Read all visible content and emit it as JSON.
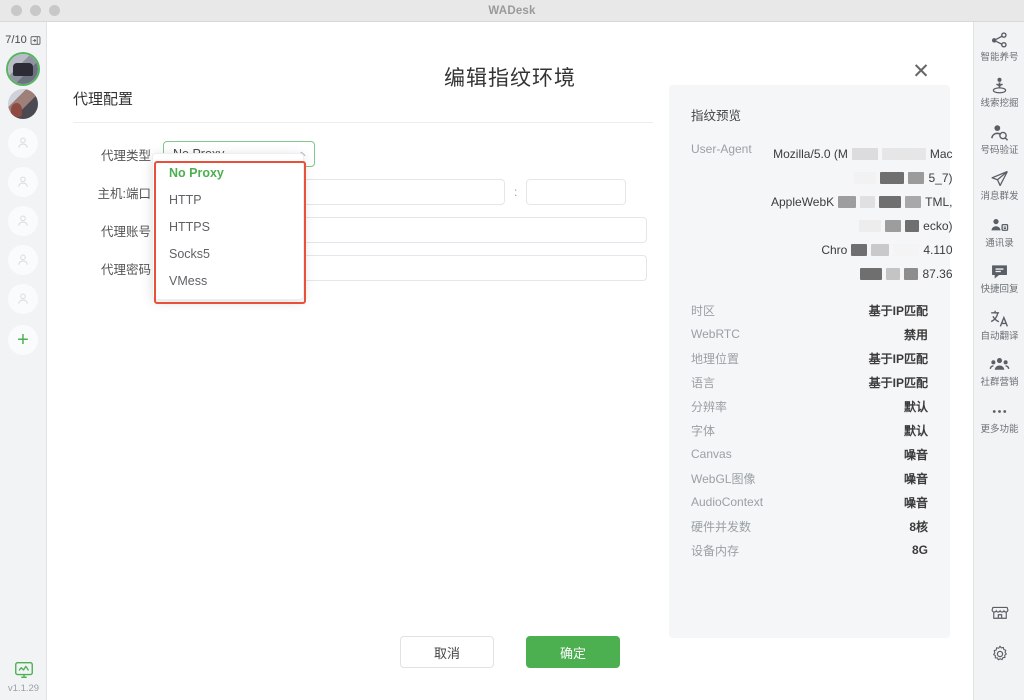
{
  "window": {
    "title": "WADesk"
  },
  "sidebar": {
    "counter": "7/10",
    "collapse_icon": "collapse-panel-icon",
    "version": "v1.1.29",
    "add_label": "+",
    "accounts": [
      {
        "name": "account-avatar-active",
        "active": true
      },
      {
        "name": "account-avatar-secondary",
        "active": false
      }
    ],
    "placeholders": 5
  },
  "rail": {
    "items": [
      {
        "label": "智能养号",
        "icon": "share-nodes-icon"
      },
      {
        "label": "线索挖掘",
        "icon": "person-radar-icon"
      },
      {
        "label": "号码验证",
        "icon": "person-search-icon"
      },
      {
        "label": "消息群发",
        "icon": "paper-plane-icon"
      },
      {
        "label": "通讯录",
        "icon": "contacts-icon"
      },
      {
        "label": "快捷回复",
        "icon": "chat-bubble-icon"
      },
      {
        "label": "自动翻译",
        "icon": "translate-icon"
      },
      {
        "label": "社群营销",
        "icon": "group-people-icon"
      },
      {
        "label": "更多功能",
        "icon": "ellipsis-icon"
      }
    ],
    "bottom": [
      {
        "icon": "store-icon"
      },
      {
        "icon": "gear-icon"
      }
    ]
  },
  "modal": {
    "title": "编辑指纹环境",
    "close_icon": "close-icon",
    "section_title": "代理配置",
    "fields": {
      "proxy_type_label": "代理类型",
      "proxy_type_value": "No Proxy",
      "host_port_label": "主机:端口",
      "host_value": "",
      "host_placeholder": "",
      "port_value": "",
      "port_placeholder": "",
      "separator": ":",
      "account_label": "代理账号",
      "account_value": "",
      "account_placeholder": "",
      "password_label": "代理密码",
      "password_value": "",
      "password_placeholder": ""
    },
    "dropdown": {
      "open": true,
      "selected": "No Proxy",
      "options": [
        "No Proxy",
        "HTTP",
        "HTTPS",
        "Socks5",
        "VMess"
      ],
      "highlight_color": "#e8503a"
    },
    "buttons": {
      "cancel": "取消",
      "confirm": "确定",
      "confirm_color": "#4caf50"
    }
  },
  "preview": {
    "title": "指纹预览",
    "user_agent": {
      "key": "User-Agent",
      "lines": [
        {
          "pre": "Mozilla/5.0 (M",
          "post": "Mac"
        },
        {
          "pre": "",
          "post": "5_7)"
        },
        {
          "pre": "AppleWebK",
          "post": "TML,"
        },
        {
          "pre": "",
          "post": "ecko)"
        },
        {
          "pre": "Chro",
          "post": "4.110"
        },
        {
          "pre": "",
          "post": "87.36"
        }
      ]
    },
    "rows": [
      {
        "key": "时区",
        "value": "基于IP匹配"
      },
      {
        "key": "WebRTC",
        "value": "禁用"
      },
      {
        "key": "地理位置",
        "value": "基于IP匹配"
      },
      {
        "key": "语言",
        "value": "基于IP匹配"
      },
      {
        "key": "分辨率",
        "value": "默认"
      },
      {
        "key": "字体",
        "value": "默认"
      },
      {
        "key": "Canvas",
        "value": "噪音"
      },
      {
        "key": "WebGL图像",
        "value": "噪音"
      },
      {
        "key": "AudioContext",
        "value": "噪音"
      },
      {
        "key": "硬件并发数",
        "value": "8核"
      },
      {
        "key": "设备内存",
        "value": "8G"
      }
    ]
  }
}
